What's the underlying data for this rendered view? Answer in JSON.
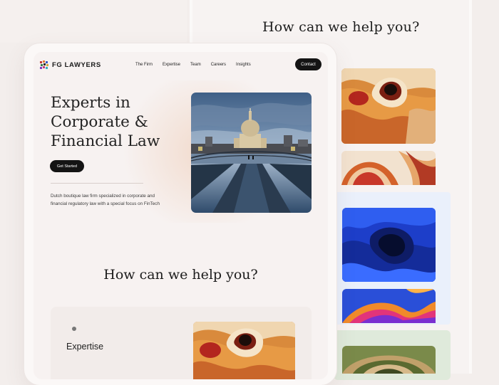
{
  "background": {
    "heading": "How can we help you?"
  },
  "brand": {
    "logo_text": "FG LAWYERS"
  },
  "nav": {
    "items": [
      "The Firm",
      "Expertise",
      "Team",
      "Careers",
      "Insights"
    ],
    "contact_label": "Contact"
  },
  "hero": {
    "title_line1": "Experts in",
    "title_line2": "Corporate &",
    "title_line3": "Financial Law",
    "cta_label": "Get Started",
    "description": "Dutch boutique law firm specialized in corporate and financial regulatory law with a special focus on FinTech"
  },
  "services": {
    "heading": "How can we help you?",
    "first_item": "Expertise"
  },
  "icons": [
    "logo-mark-icon",
    "bullet-dot-icon"
  ],
  "colors": {
    "accent_dark": "#141414",
    "page_bg": "#f3eeec",
    "screen_bg": "#f7f2f1"
  }
}
